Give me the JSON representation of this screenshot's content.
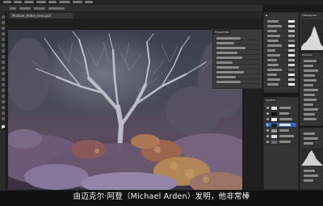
{
  "window": {
    "doc_tab_label": "Michael_Arden_tree.psd"
  },
  "panels": {
    "properties_tab": "Properties",
    "histogram_tab": "Histogram",
    "layers_tab": "Layers",
    "actions_tab": "Actions"
  },
  "subtitle": {
    "text": "由迈克尔·阿登（Michael Arden）发明，他非常棒"
  },
  "colors": {
    "accent": "#2d6cc0",
    "panel_bg": "#353535",
    "app_bg": "#1a1a1a"
  }
}
